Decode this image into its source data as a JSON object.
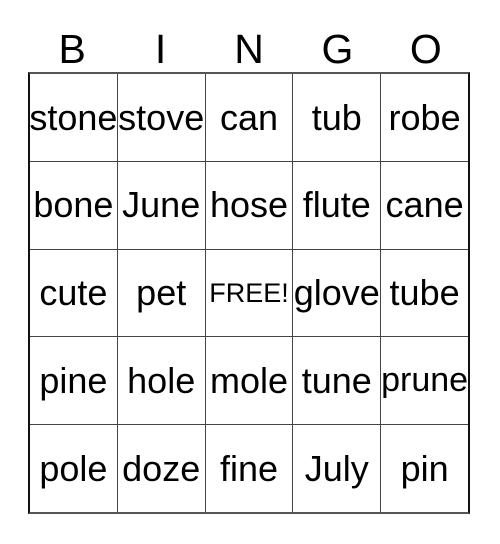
{
  "card": {
    "type": "bingo-card",
    "columns": 5,
    "rows": 5,
    "header": [
      "B",
      "I",
      "N",
      "G",
      "O"
    ],
    "grid": [
      [
        "stone",
        "stove",
        "can",
        "tub",
        "robe"
      ],
      [
        "bone",
        "June",
        "hose",
        "flute",
        "cane"
      ],
      [
        "cute",
        "pet",
        "FREE!",
        "glove",
        "tube"
      ],
      [
        "pine",
        "hole",
        "mole",
        "tune",
        "prune"
      ],
      [
        "pole",
        "doze",
        "fine",
        "July",
        "pin"
      ]
    ],
    "free_space": {
      "row": 2,
      "column": 2,
      "label": "FREE!"
    },
    "colors": {
      "background": "#ffffff",
      "text": "#000000",
      "grid_line": "#444444",
      "outer_border": "#111111"
    }
  }
}
